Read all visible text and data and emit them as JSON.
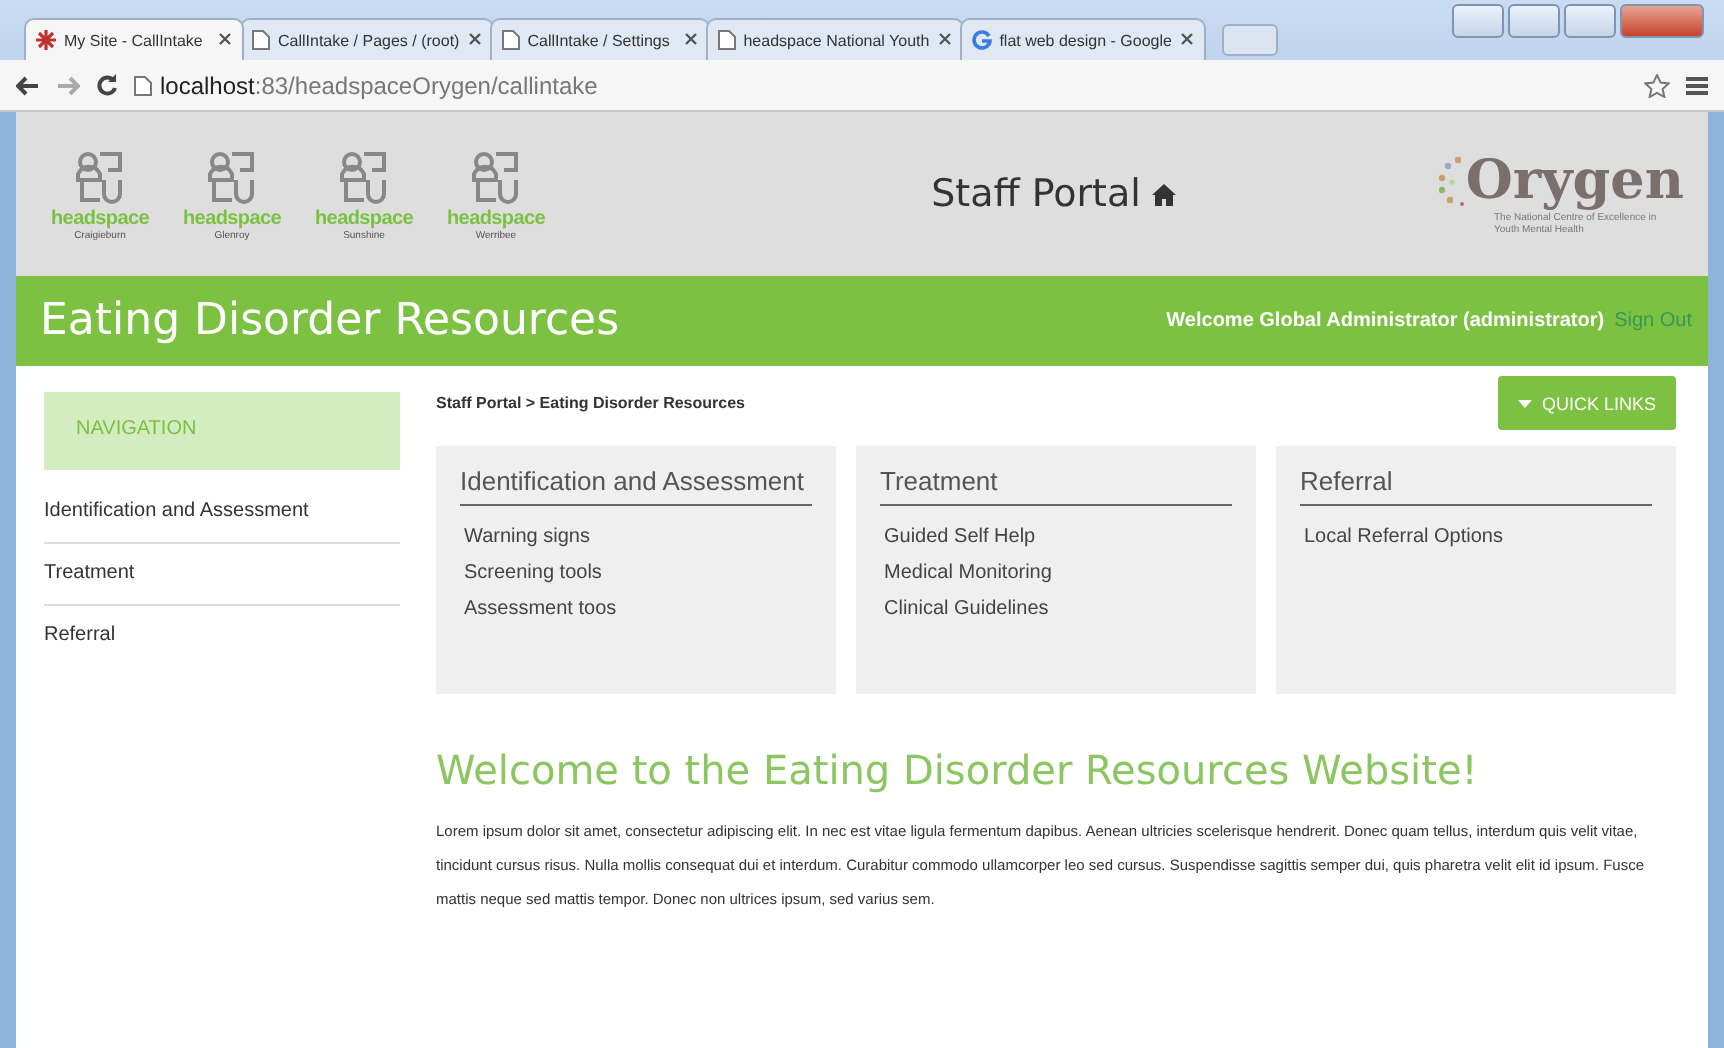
{
  "browser": {
    "tabs": [
      {
        "label": "My Site - CallIntake",
        "selected": true,
        "kind": "site"
      },
      {
        "label": "CallIntake / Pages / (root)",
        "selected": false,
        "kind": "page"
      },
      {
        "label": "CallIntake / Settings",
        "selected": false,
        "kind": "page"
      },
      {
        "label": "headspace National Youth",
        "selected": false,
        "kind": "page"
      },
      {
        "label": "flat web design - Google",
        "selected": false,
        "kind": "google"
      }
    ],
    "url_host": "localhost",
    "url_rest": ":83/headspaceOrygen/callintake"
  },
  "header": {
    "logos": [
      {
        "brand": "headspace",
        "location": "Craigieburn"
      },
      {
        "brand": "headspace",
        "location": "Glenroy"
      },
      {
        "brand": "headspace",
        "location": "Sunshine"
      },
      {
        "brand": "headspace",
        "location": "Werribee"
      }
    ],
    "portal_title": "Staff Portal",
    "org_name": "Orygen",
    "org_tagline": "The National Centre of Excellence in Youth Mental Health"
  },
  "banner": {
    "title": "Eating Disorder Resources",
    "welcome": "Welcome Global Administrator (administrator)",
    "sign_out": "Sign Out"
  },
  "navigation": {
    "heading": "NAVIGATION",
    "items": [
      "Identification and Assessment",
      "Treatment",
      "Referral"
    ]
  },
  "breadcrumb": "Staff Portal > Eating Disorder Resources",
  "quick_links": "QUICK LINKS",
  "cards": [
    {
      "title": "Identification and Assessment",
      "links": [
        "Warning signs",
        "Screening tools",
        "Assessment toos"
      ]
    },
    {
      "title": "Treatment",
      "links": [
        "Guided Self Help",
        "Medical Monitoring",
        "Clinical Guidelines"
      ]
    },
    {
      "title": "Referral",
      "links": [
        "Local Referral Options"
      ]
    }
  ],
  "welcome": {
    "heading": "Welcome to the Eating Disorder Resources Website!",
    "body": "Lorem ipsum dolor sit amet, consectetur adipiscing elit. In nec est vitae ligula fermentum dapibus. Aenean ultricies scelerisque hendrerit. Donec quam tellus, interdum quis velit vitae, tincidunt cursus risus. Nulla mollis consequat dui et interdum. Curabitur commodo ullamcorper leo sed cursus. Suspendisse sagittis semper dui, quis pharetra velit elit id ipsum. Fusce mattis neque sed mattis tempor. Donec non ultrices ipsum, sed varius sem."
  }
}
